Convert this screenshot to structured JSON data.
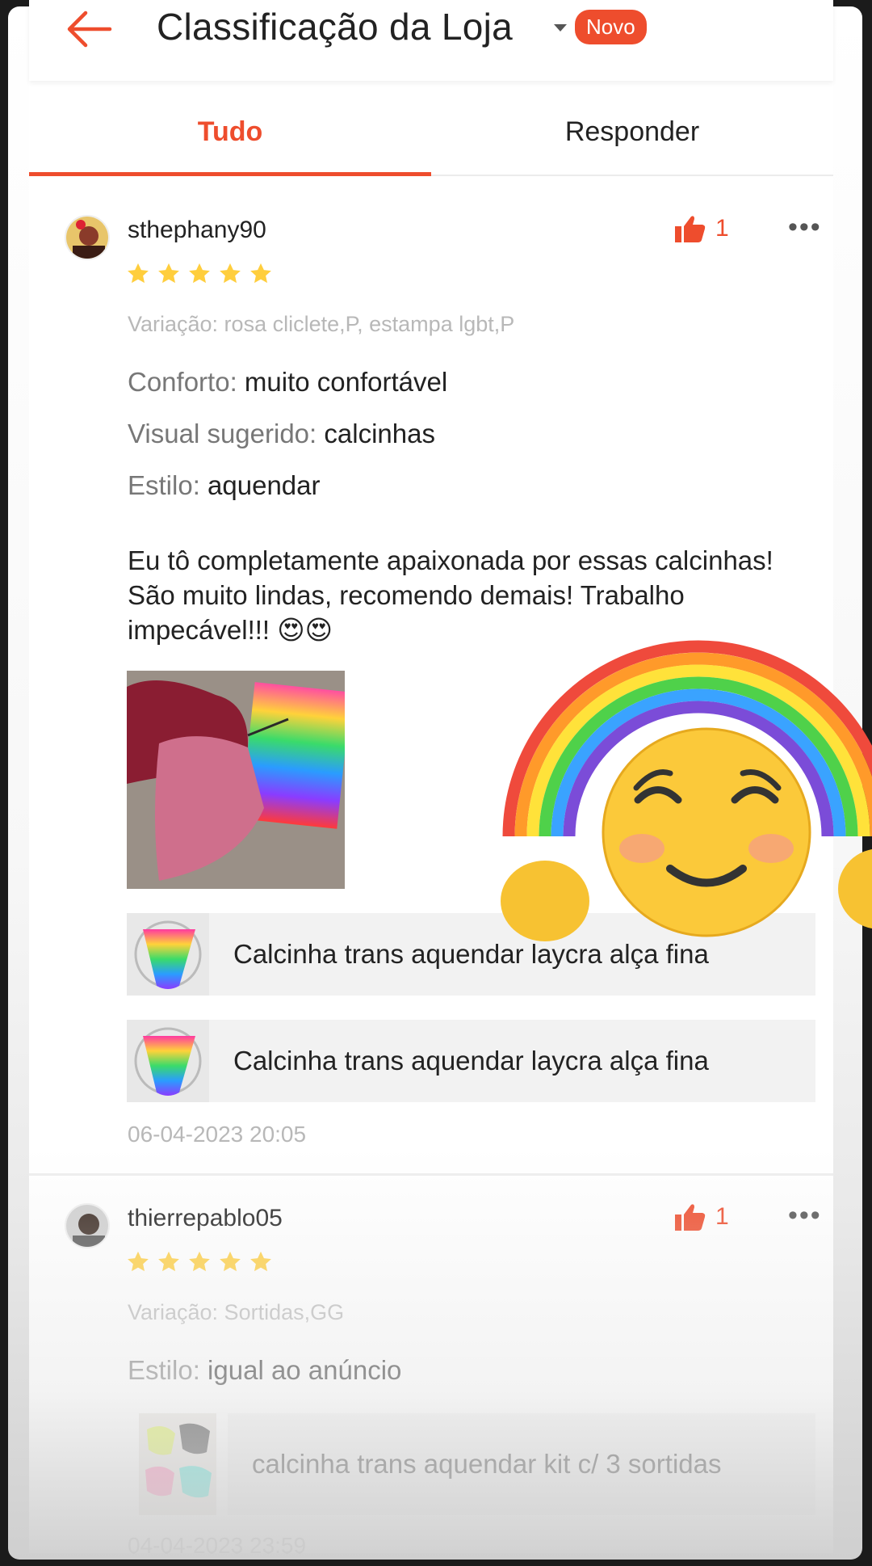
{
  "header": {
    "title": "Classificação da Loja",
    "badge": "Novo"
  },
  "tabs": [
    {
      "label": "Tudo",
      "active": true
    },
    {
      "label": "Responder",
      "active": false
    }
  ],
  "reviews": [
    {
      "username": "sthephany90",
      "likes": "1",
      "rating": 5,
      "variation": "Variação: rosa cliclete,P, estampa lgbt,P",
      "fields": [
        {
          "key": "Conforto:",
          "value": "muito confortável"
        },
        {
          "key": "Visual sugerido:",
          "value": "calcinhas"
        },
        {
          "key": "Estilo:",
          "value": "aquendar"
        }
      ],
      "text": "Eu tô completamente apaixonada por essas calcinhas! São muito lindas, recomendo demais! Trabalho impecável!!! 😍😍",
      "products": [
        {
          "name": "Calcinha trans aquendar laycra alça fina"
        },
        {
          "name": "Calcinha trans aquendar laycra alça fina"
        }
      ],
      "date": "06-04-2023 20:05"
    },
    {
      "username": "thierrepablo05",
      "likes": "1",
      "rating": 5,
      "variation": "Variação: Sortidas,GG",
      "fields": [
        {
          "key": "Estilo:",
          "value": "igual ao anúncio"
        }
      ],
      "products": [
        {
          "name": "calcinha trans aquendar  kit c/ 3 sortidas"
        }
      ],
      "date": "04-04-2023 23:59"
    }
  ],
  "icons": {
    "back": "arrow-left-icon",
    "like": "thumbs-up-icon",
    "more": "more-horizontal-icon",
    "star": "star-icon",
    "overlay": "rainbow-smiling-face-sticker"
  },
  "colors": {
    "accent": "#ee4d2d",
    "star": "#ffce3d",
    "muted": "#b8b8b8"
  }
}
